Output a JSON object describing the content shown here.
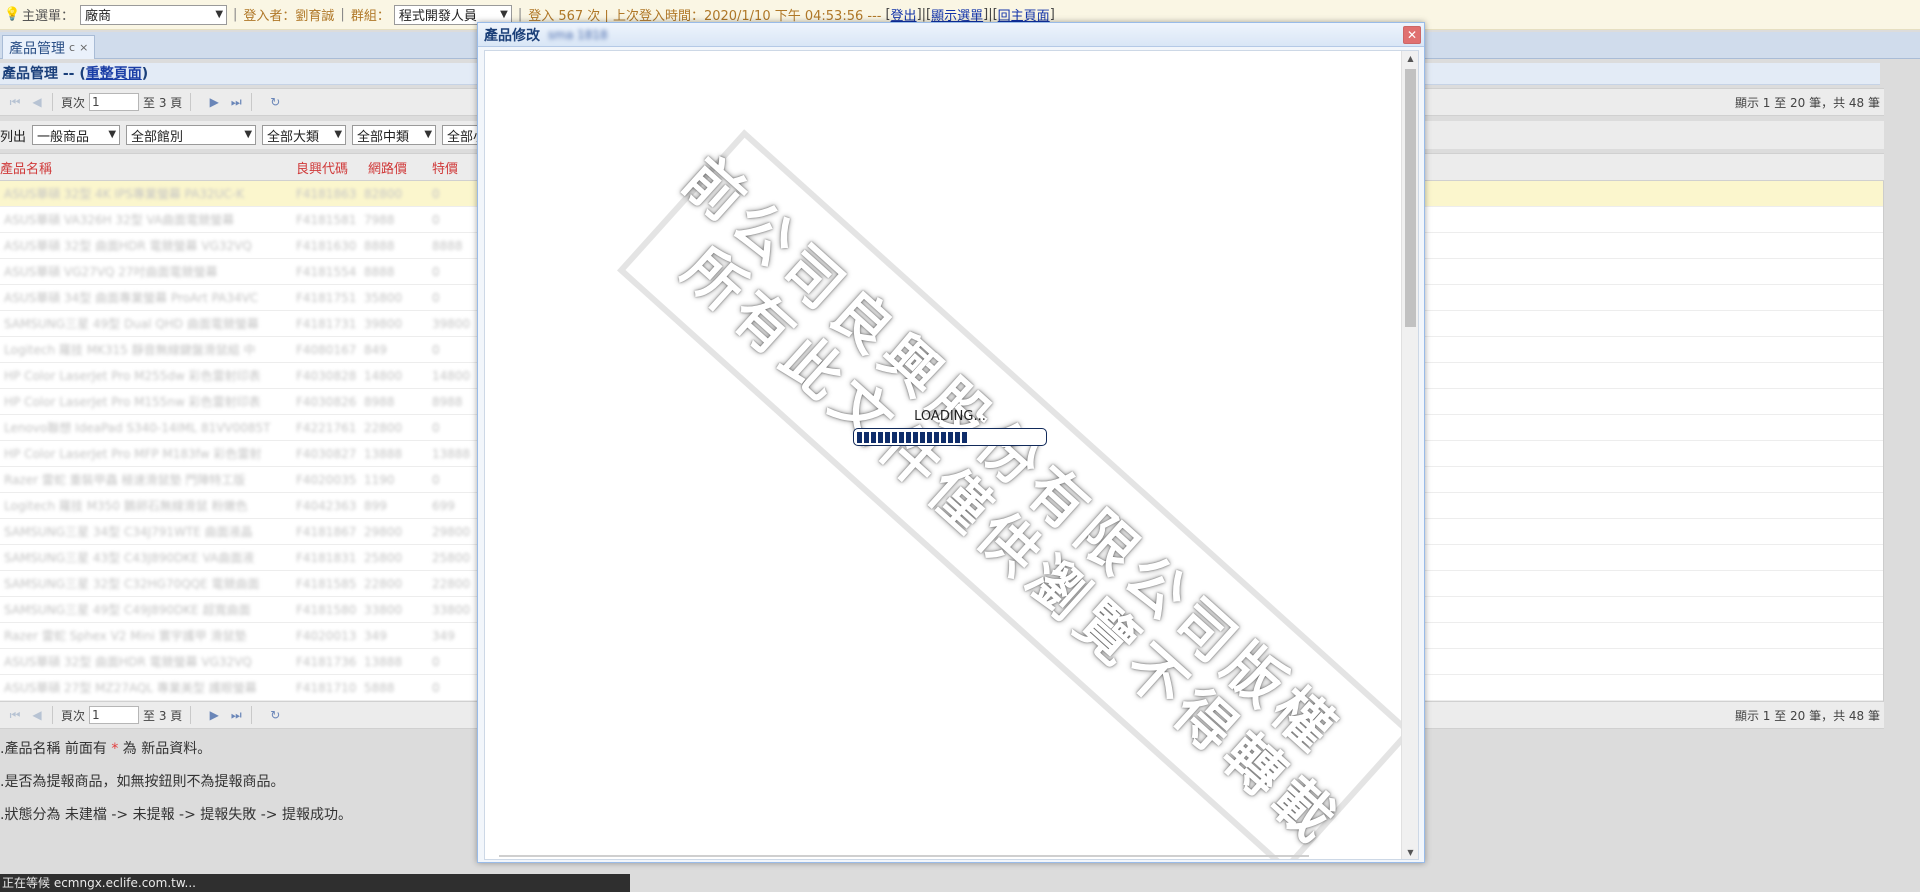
{
  "topbar": {
    "main_menu_label": "主選單：",
    "vendor_select": "廠商",
    "login_user": "登入者：劉育誠",
    "group_label": "群組：",
    "group_select": "程式開發人員",
    "login_info": "登入 567 次 | 上次登入時間：2020/1/10 下午 04:53:56 ---",
    "logout": "登出",
    "show_menu": "顯示選單",
    "home": "回主頁面"
  },
  "tab": {
    "label": "產品管理",
    "close": "×"
  },
  "panel": {
    "title": "產品管理 -- ",
    "reset_link": "重整頁面"
  },
  "pager": {
    "page_label": "頁次",
    "page_value": "1",
    "page_total": "至 3 頁",
    "display": "顯示 1 至 20 筆，共 48 筆"
  },
  "filters": {
    "list_label": "列出",
    "type_select": "一般商品",
    "store_select": "全部館別",
    "cat1_select": "全部大類",
    "cat2_select": "全部中類",
    "cat3_select": "全部小"
  },
  "grid": {
    "headers": [
      "產品名稱",
      "良興代碼",
      "網路價",
      "特價"
    ],
    "rows": [
      [
        "ASUS華碩 32型 4K IPS專業螢幕 PA32UC-K",
        "F4181863",
        "82800",
        "0"
      ],
      [
        "ASUS華碩 VA326H 32型 VA曲面電競螢幕",
        "F4181581",
        "7988",
        "0"
      ],
      [
        "ASUS華碩 32型 曲面HDR 電競螢幕 VG32VQ",
        "F4181630",
        "8888",
        "8888"
      ],
      [
        "ASUS華碩 VG27VQ 27吋曲面電競螢幕",
        "F4181554",
        "8888",
        "0"
      ],
      [
        "ASUS華碩 34型 曲面專業螢幕 ProArt PA34VC",
        "F4181751",
        "35800",
        "0"
      ],
      [
        "SAMSUNG三星 49型 Dual QHD 曲面電競螢幕",
        "F4181731",
        "39800",
        "39800"
      ],
      [
        "Logitech 羅技 MK315 靜音無線鍵盤滑鼠組 中",
        "F4080167",
        "849",
        "0"
      ],
      [
        "HP Color LaserJet Pro M255dw 彩色雷射印表",
        "F4030828",
        "14800",
        "14800"
      ],
      [
        "HP Color LaserJet Pro M155nw 彩色雷射印表",
        "F4030826",
        "8988",
        "8988"
      ],
      [
        "Lenovo聯想 IdeaPad S340-14IML 81VV0085T",
        "F4221761",
        "22800",
        "0"
      ],
      [
        "HP Color LaserJet Pro MFP M183fw 彩色雷射",
        "F4030827",
        "13888",
        "13888"
      ],
      [
        "Razer 雷蛇 重裝甲蟲 極速滑鼠墊 門陣特工版",
        "F4020035",
        "1190",
        "0"
      ],
      [
        "Logitech 羅技 M350 鵝卵石無線滑鼠 粉嫩色",
        "F4042363",
        "899",
        "699"
      ],
      [
        "SAMSUNG三星 34型 C34J791WTE 曲面液晶",
        "F4181867",
        "29800",
        "29800"
      ],
      [
        "SAMSUNG三星 43型 C43J890DKE VA曲面液",
        "F4181831",
        "25800",
        "25800"
      ],
      [
        "SAMSUNG三星 32型 C32HG70QQE 電競曲面",
        "F4181585",
        "22800",
        "22800"
      ],
      [
        "SAMSUNG三星 49型 C49J890DKE 超寬曲面",
        "F4181580",
        "33800",
        "33800"
      ],
      [
        "Razer 雷蛇 Sphex V2 Mini 寰宇護甲 滑鼠墊",
        "F4020013",
        "349",
        "349"
      ],
      [
        "ASUS華碩 32型 曲面HDR 電競螢幕 VG32VQ",
        "F4181736",
        "13888",
        "0"
      ],
      [
        "ASUS華碩 27型 MZ27AQL 專業美型 護眼螢幕",
        "F4181710",
        "5888",
        "0"
      ]
    ]
  },
  "notes": {
    "n1_a": ".產品名稱 前面有 ",
    "n1_star": "*",
    "n1_b": " 為 新品資料。",
    "n2": ".是否為提報商品，如無按鈕則不為提報商品。",
    "n3": ".狀態分為 未建檔 -> 未提報 -> 提報失敗 -> 提報成功。"
  },
  "status_bar": "正在等候 ecmngx.eclife.com.tw...",
  "dialog": {
    "title": "產品修改",
    "subtitle": "sma 1818",
    "close": "✕",
    "loading_text": "LOADING...",
    "progress": 0.6,
    "watermark_line1": "前公司良興股份有限公司版權",
    "watermark_line2": "所有此文件僅供瀏覽不得轉載"
  }
}
